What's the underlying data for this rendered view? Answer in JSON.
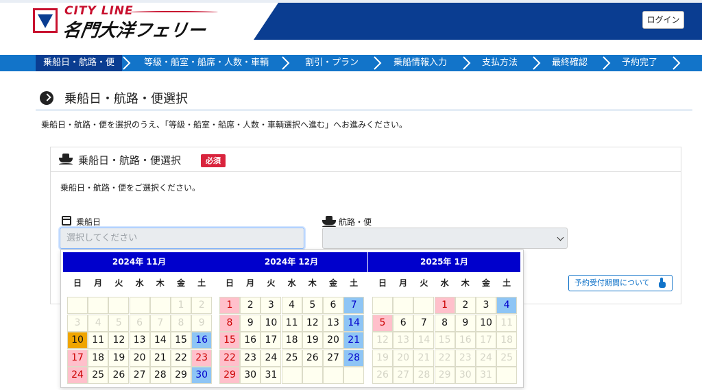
{
  "header": {
    "logo_top": "CITY LINE",
    "logo_name": "名門大洋フェリー",
    "login_label": "ログイン"
  },
  "steps": [
    {
      "label": "乗船日・航路・便",
      "active": true
    },
    {
      "label": "等級・船室・船席・人数・車輌",
      "active": false
    },
    {
      "label": "割引・プラン",
      "active": false
    },
    {
      "label": "乗船情報入力",
      "active": false
    },
    {
      "label": "支払方法",
      "active": false
    },
    {
      "label": "最終確認",
      "active": false
    },
    {
      "label": "予約完了",
      "active": false
    }
  ],
  "page": {
    "title": "乗船日・航路・便選択",
    "intro": "乗船日・航路・便を選択のうえ、「等級・船室・船席・人数・車輌選択へ進む」へお進みください。"
  },
  "panel": {
    "title": "乗船日・航路・便選択",
    "required_badge": "必須",
    "description": "乗船日・航路・便をご選択ください。",
    "date_label": "乗船日",
    "date_placeholder": "選択してください",
    "route_label": "航路・便",
    "route_value": "",
    "period_button": "予約受付期間について"
  },
  "calendar": {
    "weekdays": [
      "日",
      "月",
      "火",
      "水",
      "木",
      "金",
      "土"
    ],
    "months": [
      {
        "title": "2024年 11月",
        "weeks": [
          [
            {
              "d": ""
            },
            {
              "d": ""
            },
            {
              "d": ""
            },
            {
              "d": ""
            },
            {
              "d": ""
            },
            {
              "d": "1",
              "s": "dis"
            },
            {
              "d": "2",
              "s": "dis"
            }
          ],
          [
            {
              "d": "3",
              "s": "dis"
            },
            {
              "d": "4",
              "s": "dis"
            },
            {
              "d": "5",
              "s": "dis"
            },
            {
              "d": "6",
              "s": "dis"
            },
            {
              "d": "7",
              "s": "dis"
            },
            {
              "d": "8",
              "s": "dis"
            },
            {
              "d": "9",
              "s": "dis"
            }
          ],
          [
            {
              "d": "10",
              "s": "today"
            },
            {
              "d": "11"
            },
            {
              "d": "12"
            },
            {
              "d": "13"
            },
            {
              "d": "14"
            },
            {
              "d": "15"
            },
            {
              "d": "16",
              "s": "sat"
            }
          ],
          [
            {
              "d": "17",
              "s": "sun"
            },
            {
              "d": "18"
            },
            {
              "d": "19"
            },
            {
              "d": "20"
            },
            {
              "d": "21"
            },
            {
              "d": "22"
            },
            {
              "d": "23",
              "s": "sun"
            }
          ],
          [
            {
              "d": "24",
              "s": "sun"
            },
            {
              "d": "25"
            },
            {
              "d": "26"
            },
            {
              "d": "27"
            },
            {
              "d": "28"
            },
            {
              "d": "29"
            },
            {
              "d": "30",
              "s": "sat"
            }
          ]
        ]
      },
      {
        "title": "2024年 12月",
        "weeks": [
          [
            {
              "d": "1",
              "s": "sun"
            },
            {
              "d": "2"
            },
            {
              "d": "3"
            },
            {
              "d": "4"
            },
            {
              "d": "5"
            },
            {
              "d": "6"
            },
            {
              "d": "7",
              "s": "sat"
            }
          ],
          [
            {
              "d": "8",
              "s": "sun"
            },
            {
              "d": "9"
            },
            {
              "d": "10"
            },
            {
              "d": "11"
            },
            {
              "d": "12"
            },
            {
              "d": "13"
            },
            {
              "d": "14",
              "s": "sat"
            }
          ],
          [
            {
              "d": "15",
              "s": "sun"
            },
            {
              "d": "16"
            },
            {
              "d": "17"
            },
            {
              "d": "18"
            },
            {
              "d": "19"
            },
            {
              "d": "20"
            },
            {
              "d": "21",
              "s": "sat"
            }
          ],
          [
            {
              "d": "22",
              "s": "sun"
            },
            {
              "d": "23"
            },
            {
              "d": "24"
            },
            {
              "d": "25"
            },
            {
              "d": "26"
            },
            {
              "d": "27"
            },
            {
              "d": "28",
              "s": "sat"
            }
          ],
          [
            {
              "d": "29",
              "s": "sun"
            },
            {
              "d": "30"
            },
            {
              "d": "31"
            },
            {
              "d": ""
            },
            {
              "d": ""
            },
            {
              "d": ""
            },
            {
              "d": ""
            }
          ]
        ]
      },
      {
        "title": "2025年 1月",
        "weeks": [
          [
            {
              "d": ""
            },
            {
              "d": ""
            },
            {
              "d": ""
            },
            {
              "d": "1",
              "s": "sun"
            },
            {
              "d": "2"
            },
            {
              "d": "3"
            },
            {
              "d": "4",
              "s": "sat"
            }
          ],
          [
            {
              "d": "5",
              "s": "sun"
            },
            {
              "d": "6"
            },
            {
              "d": "7"
            },
            {
              "d": "8"
            },
            {
              "d": "9"
            },
            {
              "d": "10"
            },
            {
              "d": "11",
              "s": "dis"
            }
          ],
          [
            {
              "d": "12",
              "s": "dis"
            },
            {
              "d": "13",
              "s": "dis"
            },
            {
              "d": "14",
              "s": "dis"
            },
            {
              "d": "15",
              "s": "dis"
            },
            {
              "d": "16",
              "s": "dis"
            },
            {
              "d": "17",
              "s": "dis"
            },
            {
              "d": "18",
              "s": "dis"
            }
          ],
          [
            {
              "d": "19",
              "s": "dis"
            },
            {
              "d": "20",
              "s": "dis"
            },
            {
              "d": "21",
              "s": "dis"
            },
            {
              "d": "22",
              "s": "dis"
            },
            {
              "d": "23",
              "s": "dis"
            },
            {
              "d": "24",
              "s": "dis"
            },
            {
              "d": "25",
              "s": "dis"
            }
          ],
          [
            {
              "d": "26",
              "s": "dis"
            },
            {
              "d": "27",
              "s": "dis"
            },
            {
              "d": "28",
              "s": "dis"
            },
            {
              "d": "29",
              "s": "dis"
            },
            {
              "d": "30",
              "s": "dis"
            },
            {
              "d": "31",
              "s": "dis"
            },
            {
              "d": ""
            }
          ]
        ]
      }
    ]
  },
  "colors": {
    "brand_navy": "#0a3d91",
    "step_blue": "#1274c9",
    "calendar_header": "#0000cc",
    "saturday": "#8ec5f5",
    "holiday": "#ffc0cb",
    "today": "#f0a500",
    "required": "#d9243d"
  }
}
